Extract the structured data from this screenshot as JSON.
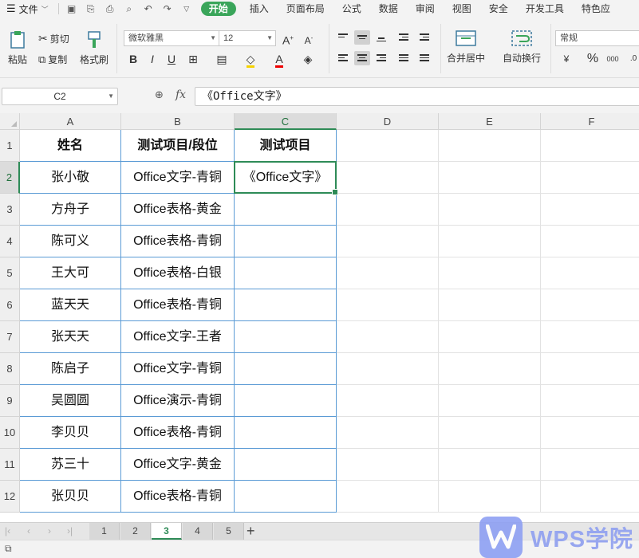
{
  "menubar": {
    "file_label": "文件",
    "tabs": [
      "开始",
      "插入",
      "页面布局",
      "公式",
      "数据",
      "审阅",
      "视图",
      "安全",
      "开发工具",
      "特色应"
    ],
    "active_tab_index": 0
  },
  "ribbon": {
    "paste_label": "粘贴",
    "cut_label": "剪切",
    "copy_label": "复制",
    "format_painter_label": "格式刷",
    "font_name": "微软雅黑",
    "font_size": "12",
    "merge_center_label": "合并居中",
    "wrap_text_label": "自动换行",
    "number_format": "常规",
    "currency_symbol": "¥",
    "percent_symbol": "%",
    "thousands_symbol": "000",
    "decimal_symbol": ".0"
  },
  "formula_bar": {
    "cell_ref": "C2",
    "fx_label": "fx",
    "formula": "《Office文字》"
  },
  "columns": [
    "A",
    "B",
    "C",
    "D",
    "E",
    "F"
  ],
  "rows": [
    "1",
    "2",
    "3",
    "4",
    "5",
    "6",
    "7",
    "8",
    "9",
    "10",
    "11",
    "12"
  ],
  "table": {
    "headers": [
      "姓名",
      "测试项目/段位",
      "测试项目"
    ],
    "rows": [
      [
        "张小敬",
        "Office文字-青铜",
        "《Office文字》"
      ],
      [
        "方舟子",
        "Office表格-黄金",
        ""
      ],
      [
        "陈可义",
        "Office表格-青铜",
        ""
      ],
      [
        "王大可",
        "Office表格-白银",
        ""
      ],
      [
        "蓝天天",
        "Office表格-青铜",
        ""
      ],
      [
        "张天天",
        "Office文字-王者",
        ""
      ],
      [
        "陈启子",
        "Office文字-青铜",
        ""
      ],
      [
        "吴圆圆",
        "Office演示-青铜",
        ""
      ],
      [
        "李贝贝",
        "Office表格-青铜",
        ""
      ],
      [
        "苏三十",
        "Office文字-黄金",
        ""
      ],
      [
        "张贝贝",
        "Office表格-青铜",
        ""
      ]
    ]
  },
  "sheets": {
    "tabs": [
      "1",
      "2",
      "3",
      "4",
      "5"
    ],
    "active_index": 2,
    "add_label": "+"
  },
  "watermark": {
    "text": "WPS学院"
  },
  "colors": {
    "accent": "#2e8b57",
    "start_tab": "#3aa55a",
    "table_border": "#5b9bd5"
  }
}
